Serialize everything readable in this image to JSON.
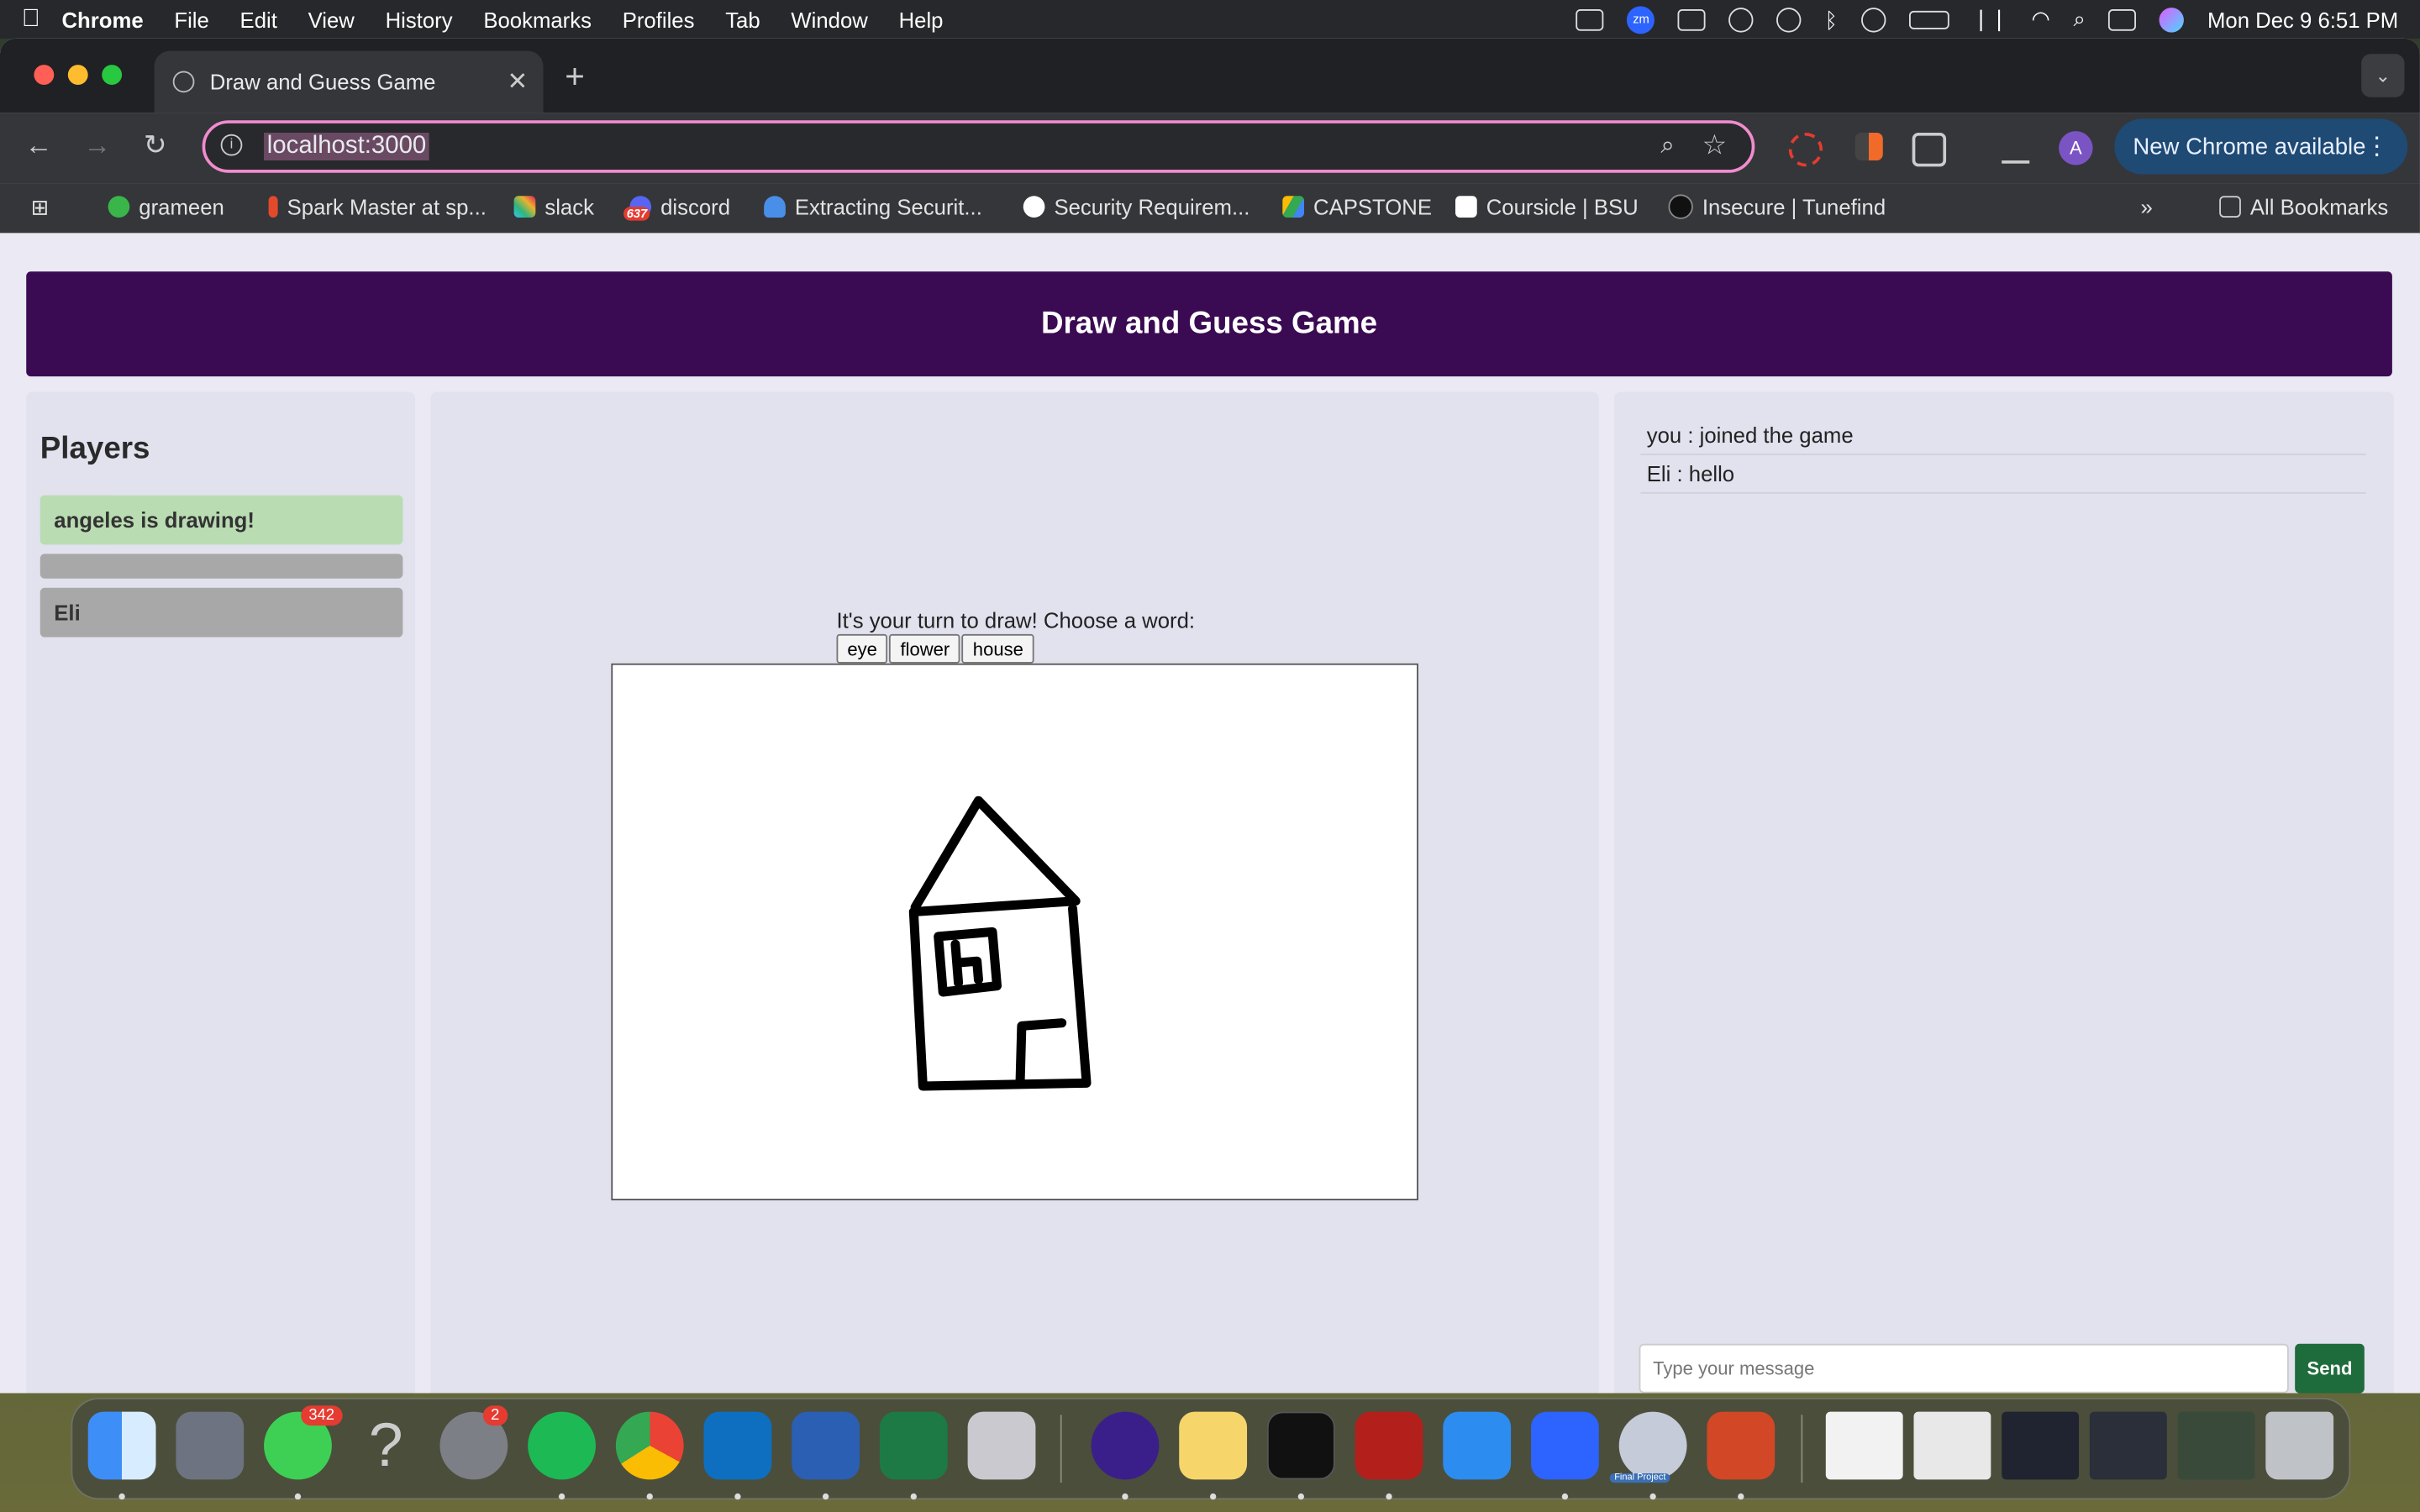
{
  "menubar": {
    "app": "Chrome",
    "items": [
      "File",
      "Edit",
      "View",
      "History",
      "Bookmarks",
      "Profiles",
      "Tab",
      "Window",
      "Help"
    ],
    "datetime": "Mon Dec 9  6:51 PM"
  },
  "browser": {
    "tab_title": "Draw and Guess Game",
    "url": "localhost:3000",
    "new_chrome": "New Chrome available",
    "avatar_letter": "A",
    "bookmarks": [
      "grameen",
      "Spark Master at sp...",
      "slack",
      "discord",
      "Extracting Securit...",
      "Security Requirem...",
      "CAPSTONE",
      "Coursicle | BSU",
      "Insecure | Tunefind"
    ],
    "all_bookmarks": "All Bookmarks",
    "discord_badge": "637"
  },
  "game": {
    "title": "Draw and Guess Game",
    "players_heading": "Players",
    "players": [
      {
        "label": "angeles is drawing!",
        "state": "drawing"
      },
      {
        "label": "",
        "state": "idle"
      },
      {
        "label": "Eli",
        "state": "idle"
      }
    ],
    "prompt": "It's your turn to draw! Choose a word:",
    "words": [
      "eye",
      "flower",
      "house"
    ],
    "chat_messages": [
      "you : joined the game",
      "Eli : hello"
    ],
    "chat_placeholder": "Type your message",
    "send_label": "Send"
  },
  "dock": {
    "messages_badge": "342",
    "settings_badge": "2",
    "r_label": "Final Project"
  },
  "colors": {
    "header_bg": "#3a0a52",
    "drawing_player_bg": "#b9dcb2",
    "idle_player_bg": "#a8a8a8",
    "send_bg": "#1e6b3b",
    "omnibox_border": "#f08ccf"
  }
}
